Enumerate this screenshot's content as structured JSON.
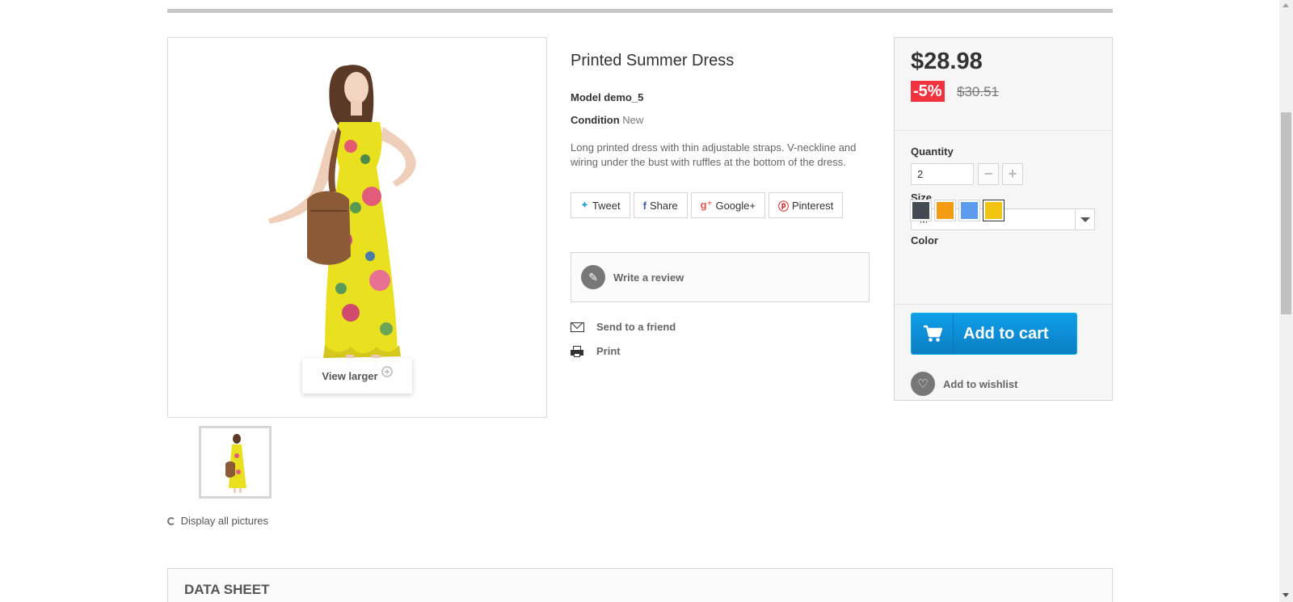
{
  "product": {
    "title": "Printed Summer Dress",
    "model_label": "Model",
    "model_value": "demo_5",
    "condition_label": "Condition",
    "condition_value": "New",
    "description": "Long printed dress with thin adjustable straps. V-neckline and wiring under the bust with ruffles at the bottom of the dress."
  },
  "image": {
    "view_larger": "View larger",
    "display_all": "Display all pictures"
  },
  "social": {
    "tweet": "Tweet",
    "share": "Share",
    "googleplus": "Google+",
    "pinterest": "Pinterest"
  },
  "actions": {
    "write_review": "Write a review",
    "send_friend": "Send to a friend",
    "print": "Print"
  },
  "buy": {
    "price": "$28.98",
    "discount": "-5%",
    "old_price": "$30.51",
    "quantity_label": "Quantity",
    "quantity_value": "2",
    "size_label": "Size",
    "size_value": "M",
    "color_label": "Color",
    "colors": [
      "#434a54",
      "#f39c11",
      "#5d9cec",
      "#f1c40f"
    ],
    "selected_color_index": 3,
    "add_to_cart": "Add to cart",
    "add_to_wishlist": "Add to wishlist"
  },
  "data_sheet": {
    "title": "DATA SHEET"
  }
}
